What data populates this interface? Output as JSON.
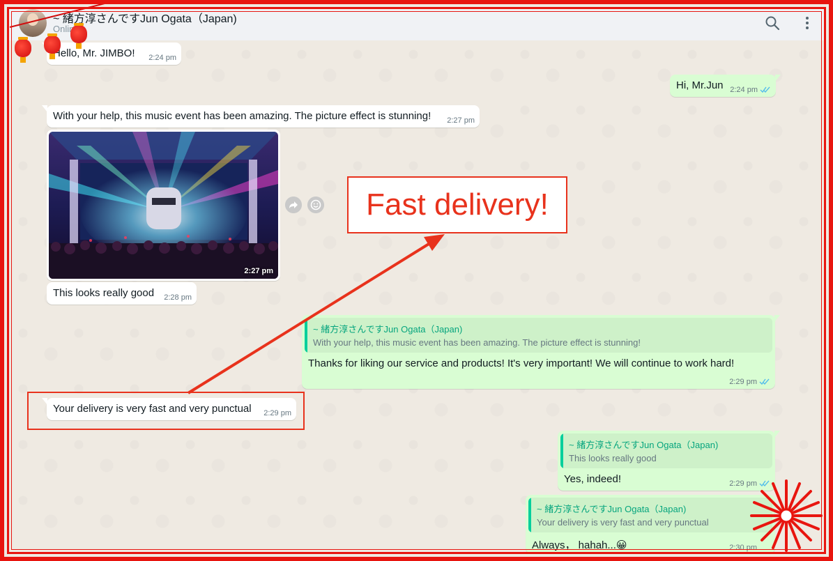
{
  "header": {
    "contact_name": "~ 緒方淳さんですJun Ogata（Japan)",
    "status": "Online"
  },
  "messages": [
    {
      "text": "Hello, Mr. JIMBO!",
      "time": "2:24 pm"
    },
    {
      "text": "Hi, Mr.Jun",
      "time": "2:24 pm"
    },
    {
      "text": "With your help, this music event has been amazing. The picture effect is stunning!",
      "time": "2:27 pm"
    },
    {
      "image_time": "2:27 pm"
    },
    {
      "text": "This looks really good",
      "time": "2:28 pm"
    },
    {
      "quote_name": "~ 緒方淳さんですJun Ogata（Japan)",
      "quote_text": "With your help, this music event has been amazing. The picture effect is stunning!",
      "text": "Thanks for liking our service and products! It's very important! We will continue to work hard!",
      "time": "2:29 pm"
    },
    {
      "text": "Your delivery is very fast and very punctual",
      "time": "2:29 pm"
    },
    {
      "quote_name": "~ 緒方淳さんですJun Ogata（Japan)",
      "quote_text": "This looks really good",
      "text": "Yes, indeed!",
      "time": "2:29 pm"
    },
    {
      "quote_name": "~ 緒方淳さんですJun Ogata（Japan)",
      "quote_text": "Your delivery is very fast and very punctual",
      "text": "Always， hahah...😀",
      "time": "2:30 pm"
    }
  ],
  "annotation": {
    "callout_text": "Fast delivery!"
  },
  "colors": {
    "frame": "#e8150f",
    "incoming_bubble": "#ffffff",
    "outgoing_bubble": "#d9fdd3",
    "quote_name": "#06a57e",
    "read_ticks": "#53bdeb",
    "annotation": "#e8321c"
  },
  "icons": {
    "header_search": "search-icon",
    "header_menu": "menu-dots-icon",
    "forward": "forward-icon",
    "react": "emoji-icon",
    "ticks": "double-check-icon"
  }
}
